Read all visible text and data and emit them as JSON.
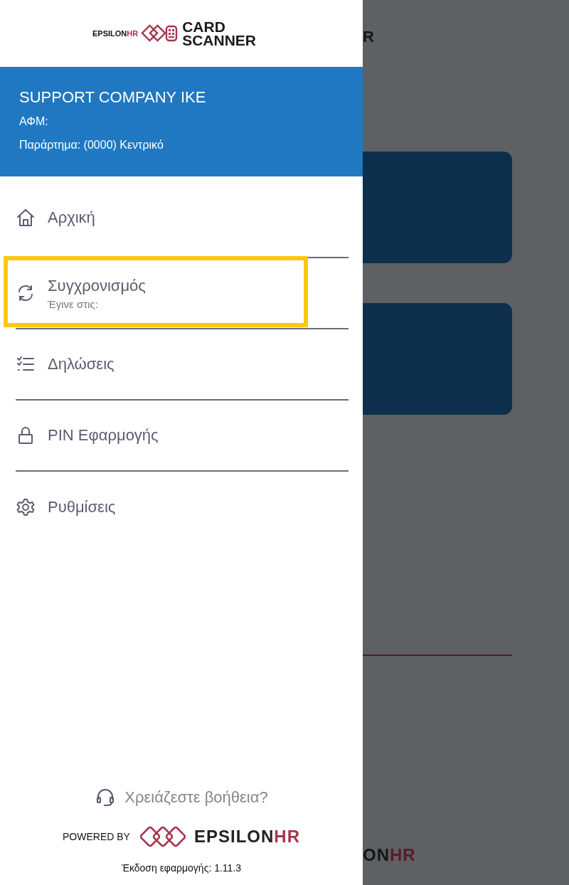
{
  "drawer": {
    "logo": {
      "brand": "EPSILON",
      "brand_accent": "HR",
      "product_line_1": "CARD",
      "product_line_2": "SCANNER"
    },
    "account": {
      "company": "SUPPORT COMPANY IKE",
      "tax_id_label": "ΑΦΜ:",
      "branch": "Παράρτημα: (0000) Κεντρικό"
    },
    "menu": [
      {
        "kind": "home",
        "label": "Αρχική",
        "highlighted": false
      },
      {
        "kind": "sync",
        "label": "Συγχρονισμός",
        "subtitle": "Έγινε στις:",
        "highlighted": true
      },
      {
        "kind": "declarations",
        "label": "Δηλώσεις",
        "highlighted": false
      },
      {
        "kind": "pin",
        "label": "PIN Εφαρμογής",
        "highlighted": false
      },
      {
        "kind": "settings",
        "label": "Ρυθμίσεις",
        "highlighted": false
      }
    ],
    "help": "Χρειάζεστε βοήθεια?",
    "powered_by": {
      "label": "POWERED BY",
      "brand": "EPSILON",
      "brand_accent": "HR"
    },
    "version": "Έκδοση εφαρμογής: 1.11.3"
  },
  "background_screen": {
    "top_logo_tail": "R",
    "bottom_logo_tail": "ON",
    "bottom_logo_accent": "HR"
  }
}
